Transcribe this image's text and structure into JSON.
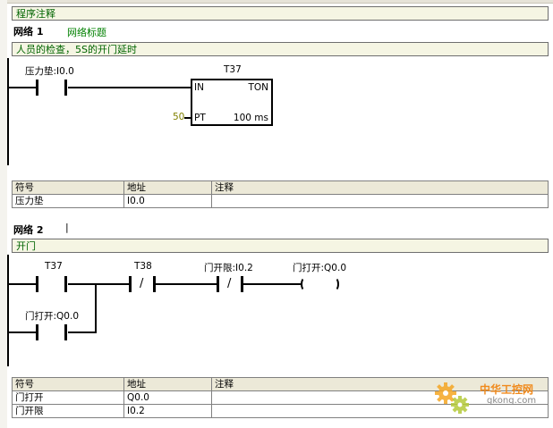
{
  "program_comment": "程序注释",
  "networks": [
    {
      "label": "网络 1",
      "title": "网络标题",
      "comment": "人员的检查，5S的开门延时",
      "contacts": {
        "pressure_mat": "压力垫:I0.0"
      },
      "timer": {
        "name": "T37",
        "in_label": "IN",
        "type": "TON",
        "pt_label": "PT",
        "pt_value": "50",
        "resolution": "100 ms"
      },
      "symbol_table": {
        "headers": [
          "符号",
          "地址",
          "注释"
        ],
        "rows": [
          [
            "压力垫",
            "I0.0",
            ""
          ]
        ]
      }
    },
    {
      "label": "网络 2",
      "cursor": "|",
      "comment": "开门",
      "contacts": {
        "t37": "T37",
        "t38": "T38",
        "door_limit": "门开限:I0.2",
        "door_open_hold": "门打开:Q0.0"
      },
      "coil": "门打开:Q0.0",
      "symbol_table": {
        "headers": [
          "符号",
          "地址",
          "注释"
        ],
        "rows": [
          [
            "门打开",
            "Q0.0",
            ""
          ],
          [
            "门开限",
            "I0.2",
            ""
          ]
        ]
      }
    }
  ],
  "watermark": {
    "line1": "中华工控网",
    "line2": "gkong.com"
  },
  "colors": {
    "comment_bg": "#f5f5e3",
    "title_green": "#008000",
    "number_olive": "#808000",
    "watermark": "#f08a1c"
  }
}
